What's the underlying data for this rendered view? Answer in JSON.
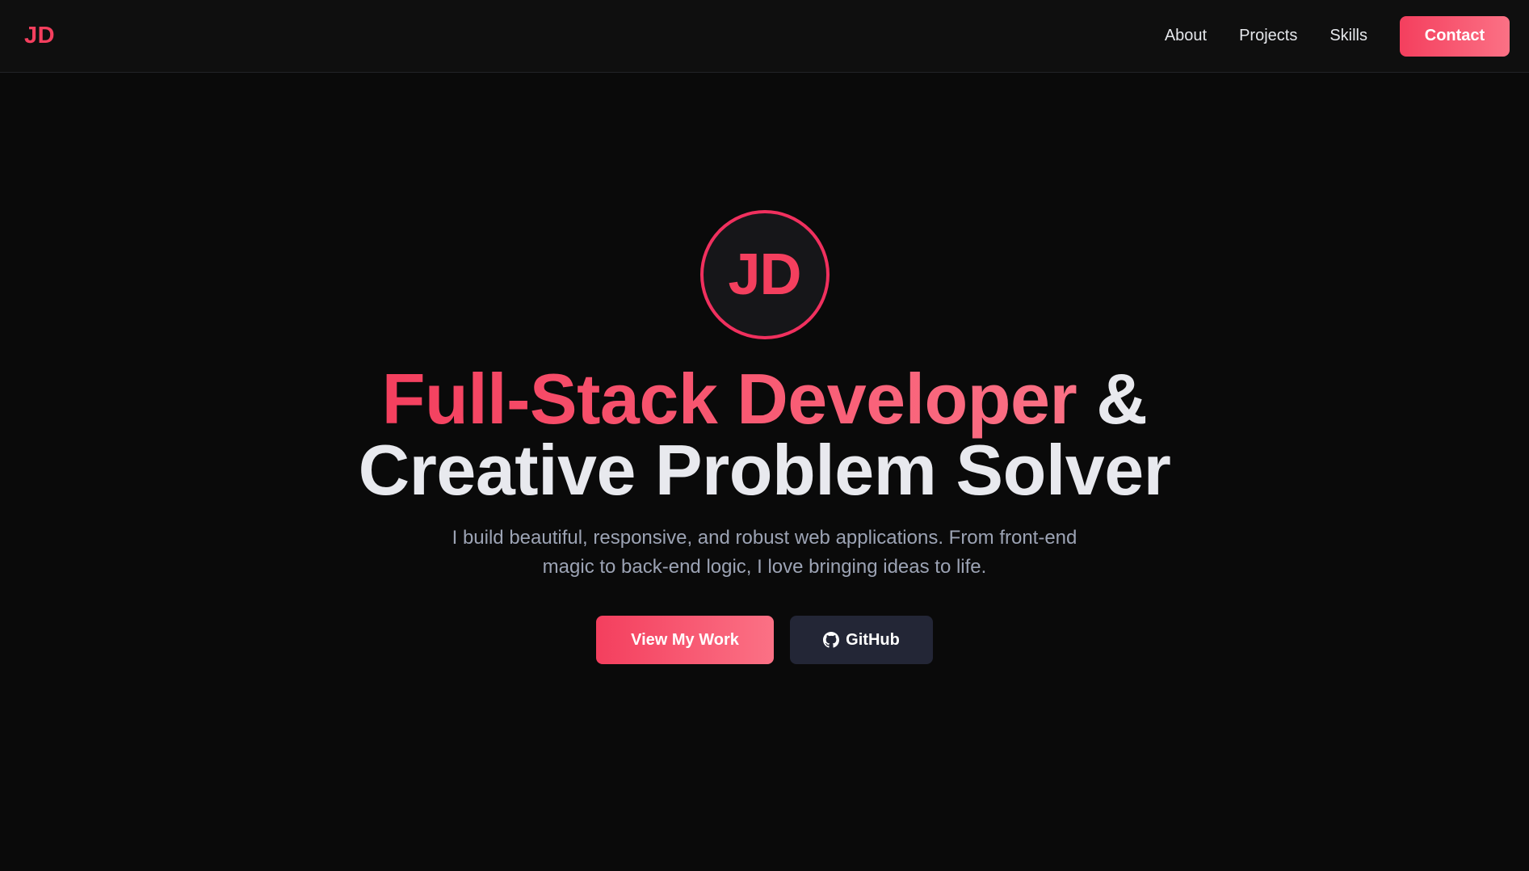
{
  "colors": {
    "accent_start": "#f43f5e",
    "accent_end": "#fb7185",
    "accent_solid": "#f0305e",
    "background": "#0a0a0a",
    "nav_background": "#0f0f0f",
    "secondary_button": "#232636"
  },
  "navbar": {
    "logo": "JD",
    "links": [
      {
        "label": "About"
      },
      {
        "label": "Projects"
      },
      {
        "label": "Skills"
      }
    ],
    "contact_label": "Contact"
  },
  "hero": {
    "avatar_initials": "JD",
    "headline_accent": "Full-Stack Developer",
    "headline_ampersand": "&",
    "headline_line2": "Creative Problem Solver",
    "subtitle": "I build beautiful, responsive, and robust web applications. From front-end magic to back-end logic, I love bringing ideas to life.",
    "primary_button": "View My Work",
    "secondary_button": "GitHub",
    "secondary_button_icon": "github-icon"
  }
}
